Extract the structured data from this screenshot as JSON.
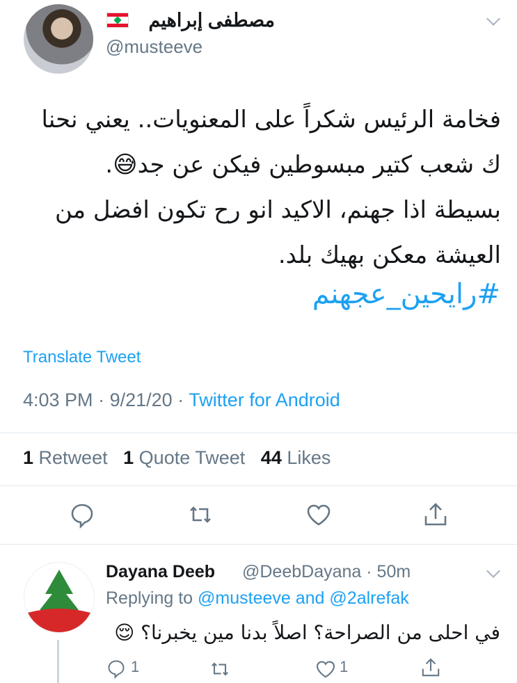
{
  "main_tweet": {
    "author_name": "مصطفى إبراهيم",
    "handle": "@musteeve",
    "text": "فخامة الرئيس شكراً على المعنويات.. يعني نحنا\nك شعب كتير مبسوطين فيكن عن جد😅.\nبسيطة اذا جهنم، الاكيد انو رح تكون افضل من\nالعيشة معكن بهيك بلد.",
    "hashtag": "#رايحين_عجهنم",
    "translate_label": "Translate Tweet",
    "time": "4:03 PM",
    "date": "9/21/20",
    "separator": "·",
    "source": "Twitter for Android",
    "retweets_count": "1",
    "retweets_label": "Retweet",
    "quotes_count": "1",
    "quotes_label": "Quote Tweet",
    "likes_count": "44",
    "likes_label": "Likes"
  },
  "reply": {
    "author_name": "Dayana Deeb",
    "handle": "@DeebDayana",
    "time": "· 50m",
    "replying_prefix": "Replying to",
    "replying_user1": "@musteeve",
    "replying_and": "and",
    "replying_user2": "@2alrefak",
    "text": "في احلى من الصراحة؟ اصلاً بدنا مين يخبرنا؟ 😌",
    "reply_count": "1",
    "like_count": "1"
  },
  "colors": {
    "accent": "#1da1f2",
    "muted": "#657786",
    "text": "#14171a",
    "divider": "#e1e8ed"
  },
  "icons": [
    "chevron-down-icon",
    "reply-icon",
    "retweet-icon",
    "like-icon",
    "share-icon",
    "lebanon-flag-icon"
  ]
}
